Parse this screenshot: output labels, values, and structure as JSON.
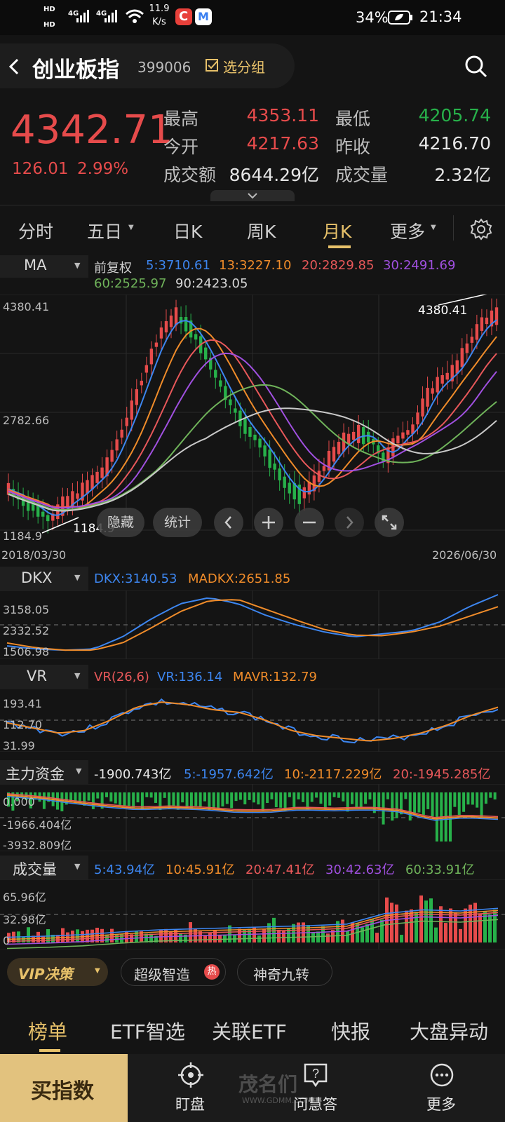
{
  "status": {
    "signal1": "HD",
    "signal2": "HD",
    "net1": "4G",
    "net2": "4G",
    "speed_value": "11.9",
    "speed_unit": "K/s",
    "battery": "34%",
    "time": "21:34"
  },
  "header": {
    "title": "创业板指",
    "code": "399006",
    "group_label": "选分组"
  },
  "quote": {
    "price": "4342.71",
    "change": "126.01",
    "change_pct": "2.99%",
    "high_label": "最高",
    "high": "4353.11",
    "low_label": "最低",
    "low": "4205.74",
    "open_label": "今开",
    "open": "4217.63",
    "prev_label": "昨收",
    "prev": "4216.70",
    "amount_label": "成交额",
    "amount": "8644.29亿",
    "volume_label": "成交量",
    "volume": "2.32亿"
  },
  "tabs": [
    {
      "label": "分时"
    },
    {
      "label": "五日"
    },
    {
      "label": "日K"
    },
    {
      "label": "周K"
    },
    {
      "label": "月K"
    },
    {
      "label": "更多"
    }
  ],
  "main_chart": {
    "indicator": "MA",
    "adjust": "前复权",
    "ma": [
      "5:3710.61",
      "13:3227.10",
      "20:2829.85",
      "30:2491.69",
      "60:2525.97",
      "90:2423.05"
    ],
    "y_top": "4380.41",
    "y_mid": "2782.66",
    "y_bot": "1184.9",
    "marker_high": "4380.41",
    "marker_low": "1184.9",
    "date_start": "2018/03/30",
    "date_end": "2026/06/30",
    "buttons": {
      "hide": "隐藏",
      "stats": "统计"
    }
  },
  "dkx": {
    "name": "DKX",
    "dkx": "DKX:3140.53",
    "madkx": "MADKX:2651.85",
    "y1": "3158.05",
    "y2": "2332.52",
    "y3": "1506.98"
  },
  "vr": {
    "name": "VR",
    "params": "VR(26,6)",
    "vr": "VR:136.14",
    "mavr": "MAVR:132.79",
    "y1": "193.41",
    "y2": "112.70",
    "y3": "31.99"
  },
  "flow": {
    "name": "主力资金",
    "cur": "-1900.743亿",
    "m5": "5:-1957.642亿",
    "m10": "10:-2117.229亿",
    "m20": "20:-1945.285亿",
    "y1": "0.000",
    "y2": "-1966.404亿",
    "y3": "-3932.809亿"
  },
  "vol": {
    "name": "成交量",
    "m5": "5:43.94亿",
    "m10": "10:45.91亿",
    "m20": "20:47.41亿",
    "m30": "30:42.63亿",
    "m60": "60:33.91亿",
    "y1": "65.96亿",
    "y2": "32.98亿",
    "y3": "0"
  },
  "chips": {
    "vip": "VIP决策",
    "smart": "超级智造",
    "hot": "热",
    "nine": "神奇九转"
  },
  "bottom_tabs": [
    {
      "label": "榜单"
    },
    {
      "label": "ETF智选"
    },
    {
      "label": "关联ETF"
    },
    {
      "label": "快报"
    },
    {
      "label": "大盘异动"
    }
  ],
  "bottom_bar": {
    "buy": "买指数",
    "watch": "盯盘",
    "ask": "问慧答",
    "more": "更多",
    "watermark": "茂名们",
    "watermark_url": "WWW.GDMM.COM"
  },
  "colors": {
    "up": "#e64b4b",
    "down": "#27b14a",
    "ma5": "#3d86f0",
    "ma13": "#f08c2a",
    "ma20": "#e8585a",
    "ma30": "#a050e0",
    "ma60": "#6fb35a",
    "ma90": "#c9c9c9"
  }
}
